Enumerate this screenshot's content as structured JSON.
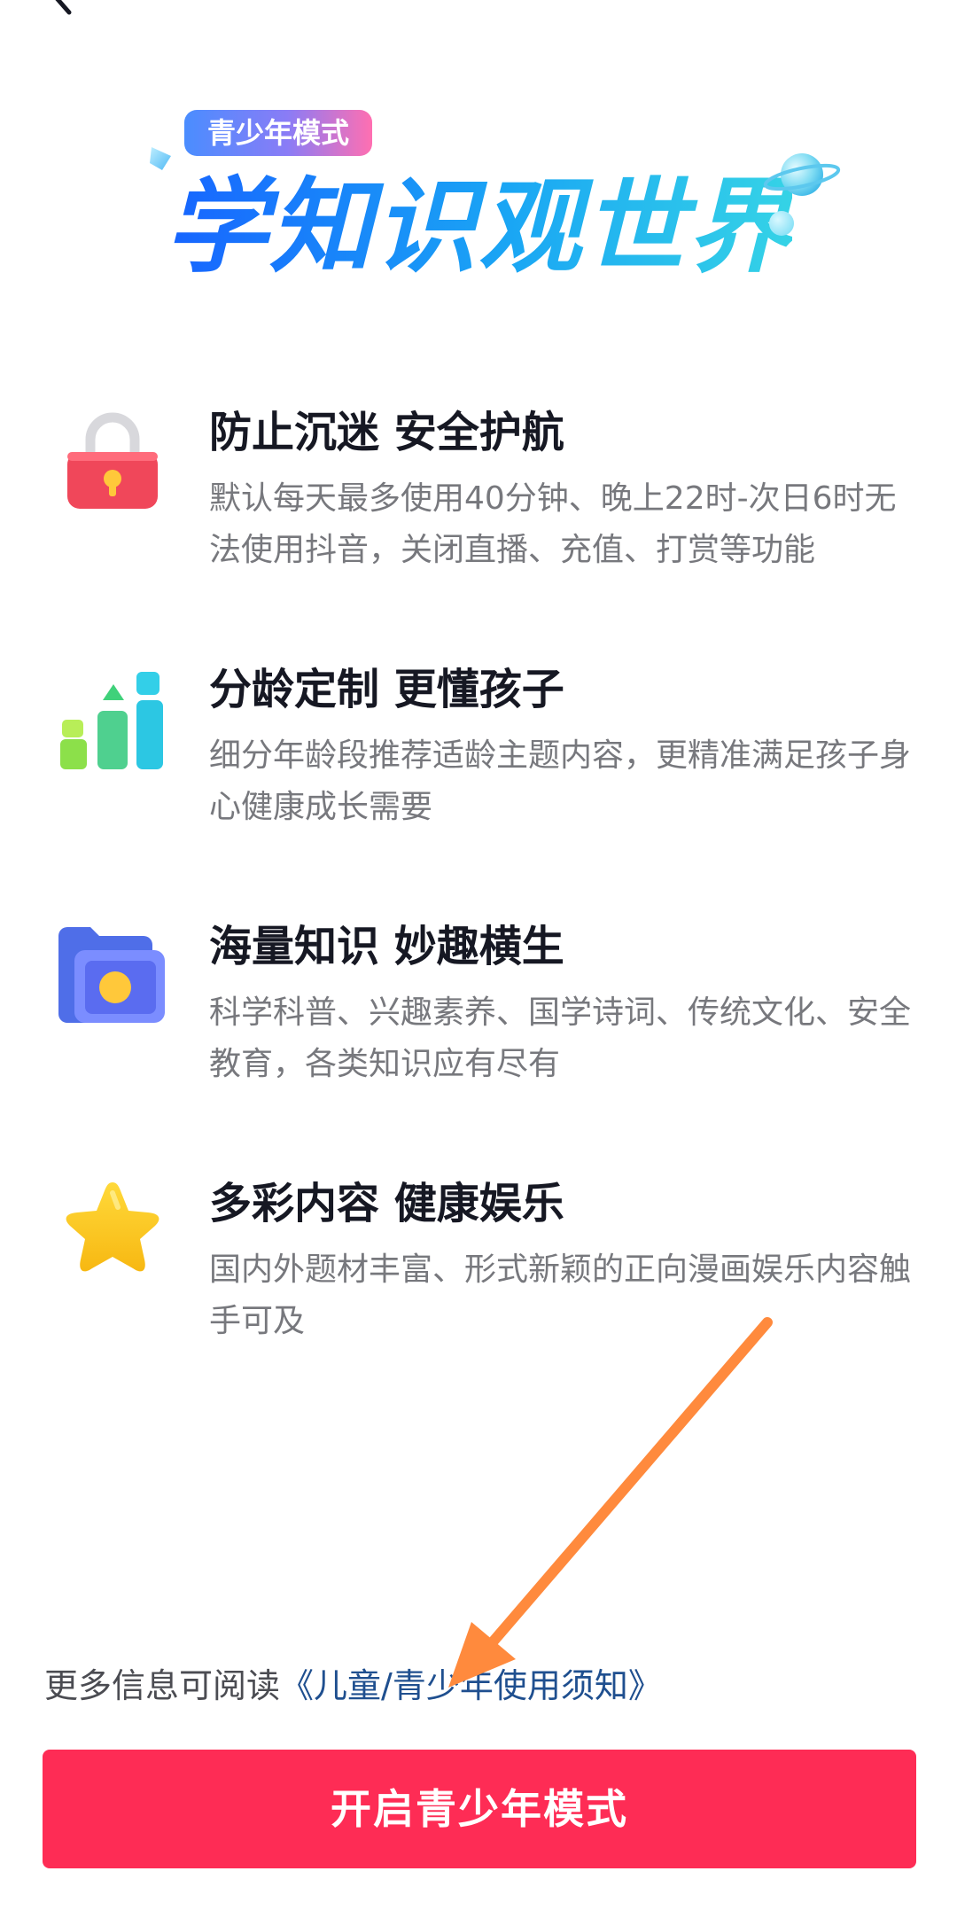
{
  "hero": {
    "badge": "青少年模式",
    "title": "学知识观世界"
  },
  "features": [
    {
      "title": "防止沉迷 安全护航",
      "description": "默认每天最多使用40分钟、晚上22时-次日6时无法使用抖音，关闭直播、充值、打赏等功能",
      "icon": "lock-icon"
    },
    {
      "title": "分龄定制 更懂孩子",
      "description": "细分年龄段推荐适龄主题内容，更精准满足孩子身心健康成长需要",
      "icon": "growth-bars-icon"
    },
    {
      "title": "海量知识 妙趣横生",
      "description": "科学科普、兴趣素养、国学诗词、传统文化、安全教育，各类知识应有尽有",
      "icon": "video-folder-icon"
    },
    {
      "title": "多彩内容 健康娱乐",
      "description": "国内外题材丰富、形式新颖的正向漫画娱乐内容触手可及",
      "icon": "star-icon"
    }
  ],
  "footer": {
    "info_prefix": "更多信息可阅读",
    "info_link": "《儿童/青少年使用须知》",
    "cta_label": "开启青少年模式"
  },
  "colors": {
    "cta_background": "#fe2c55",
    "link": "#1f4f8f",
    "title_gradient_start": "#1764ff",
    "title_gradient_end": "#35d3e6",
    "annotation_arrow": "#ff8a3d"
  }
}
